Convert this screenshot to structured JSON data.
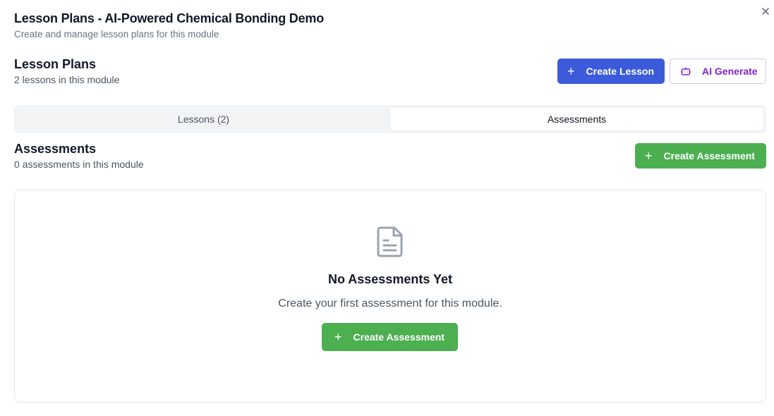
{
  "dialog": {
    "title": "Lesson Plans - AI-Powered Chemical Bonding Demo",
    "subtitle": "Create and manage lesson plans for this module"
  },
  "lesson_plans": {
    "heading": "Lesson Plans",
    "count_text": "2 lessons in this module",
    "create_label": "Create Lesson",
    "ai_label": "AI Generate"
  },
  "tabs": [
    {
      "label": "Lessons (2)",
      "active": false
    },
    {
      "label": "Assessments",
      "active": true
    }
  ],
  "assessments": {
    "heading": "Assessments",
    "count_text": "0 assessments in this module",
    "create_label": "Create Assessment"
  },
  "empty_state": {
    "icon": "document-icon",
    "title": "No Assessments Yet",
    "text": "Create your first assessment for this module.",
    "button_label": "Create Assessment"
  },
  "colors": {
    "primary": "#3b5bdb",
    "success": "#4caf50",
    "ai_accent": "#7e22ce"
  }
}
